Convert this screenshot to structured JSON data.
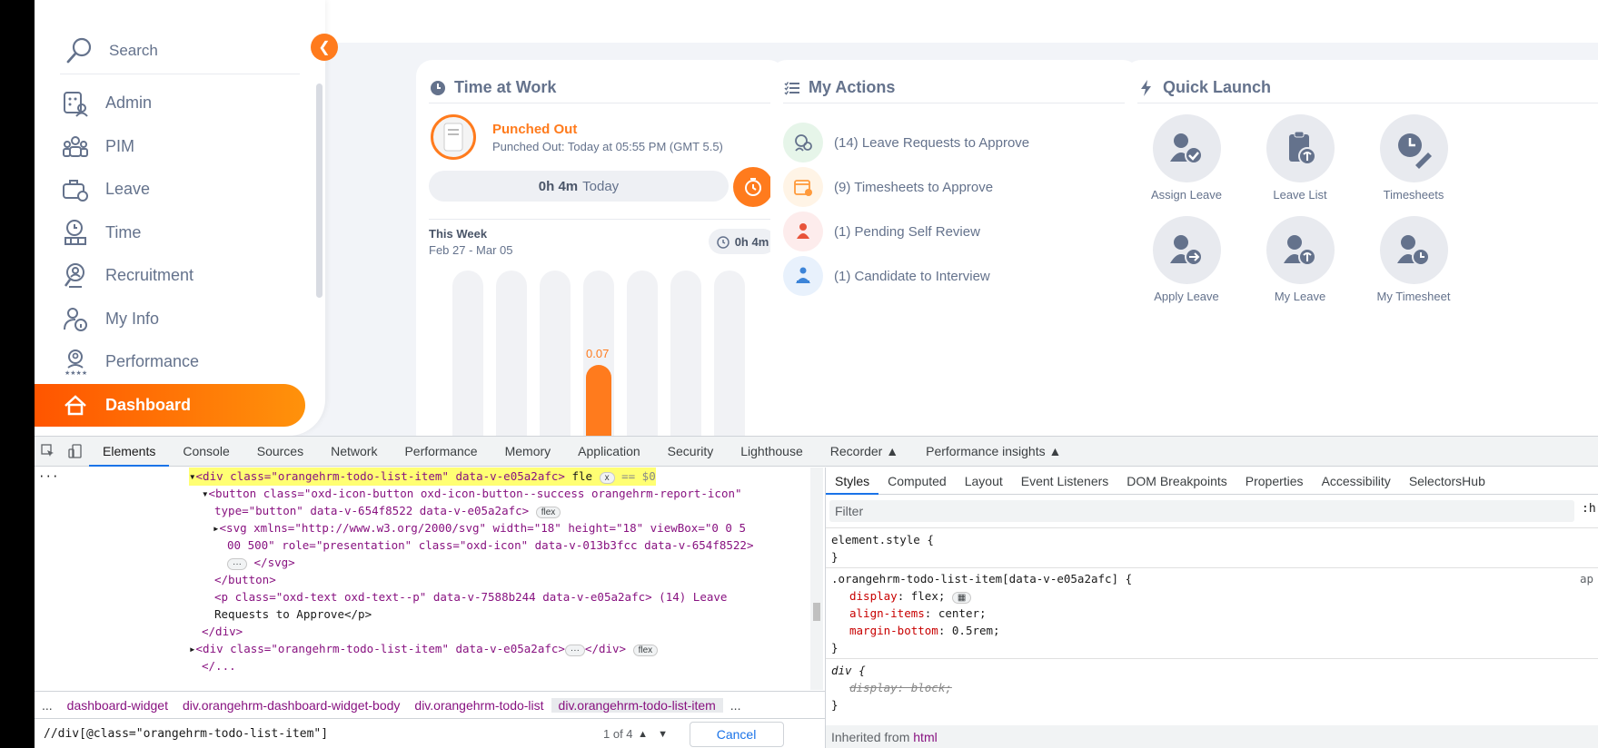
{
  "sidebar": {
    "search_label": "Search",
    "items": [
      {
        "label": "Admin",
        "icon": "admin-icon"
      },
      {
        "label": "PIM",
        "icon": "pim-icon"
      },
      {
        "label": "Leave",
        "icon": "leave-icon"
      },
      {
        "label": "Time",
        "icon": "time-icon"
      },
      {
        "label": "Recruitment",
        "icon": "recruitment-icon"
      },
      {
        "label": "My Info",
        "icon": "my-info-icon"
      },
      {
        "label": "Performance",
        "icon": "performance-icon"
      },
      {
        "label": "Dashboard",
        "icon": "dashboard-icon",
        "active": true
      }
    ],
    "accent": "#ff7b1d"
  },
  "time_at_work": {
    "title": "Time at Work",
    "status": "Punched Out",
    "status_detail": "Punched Out: Today at 05:55 PM (GMT 5.5)",
    "today_hours": "0h 4m",
    "today_label": "Today",
    "week_title": "This Week",
    "week_range": "Feb 27 - Mar 05",
    "week_total": "0h 4m",
    "bar_value_label": "0.07",
    "chart_data": {
      "type": "bar",
      "values": [
        0,
        0,
        0,
        0.07,
        0,
        0,
        0
      ]
    }
  },
  "my_actions": {
    "title": "My Actions",
    "items": [
      {
        "label": "(14) Leave Requests to Approve",
        "icon": "leave-request-icon",
        "bg": "#e6f5e9"
      },
      {
        "label": "(9) Timesheets to Approve",
        "icon": "timesheet-icon",
        "bg": "#fff4e6"
      },
      {
        "label": "(1) Pending Self Review",
        "icon": "self-review-icon",
        "bg": "#fdecec"
      },
      {
        "label": "(1) Candidate to Interview",
        "icon": "candidate-icon",
        "bg": "#e8f1fc"
      }
    ]
  },
  "quick_launch": {
    "title": "Quick Launch",
    "items": [
      {
        "label": "Assign Leave",
        "icon": "assign-leave-icon"
      },
      {
        "label": "Leave List",
        "icon": "leave-list-icon"
      },
      {
        "label": "Timesheets",
        "icon": "timesheets-icon"
      },
      {
        "label": "Apply Leave",
        "icon": "apply-leave-icon"
      },
      {
        "label": "My Leave",
        "icon": "my-leave-icon"
      },
      {
        "label": "My Timesheet",
        "icon": "my-timesheet-icon"
      }
    ]
  },
  "devtools": {
    "tabs": [
      "Elements",
      "Console",
      "Sources",
      "Network",
      "Performance",
      "Memory",
      "Application",
      "Security",
      "Lighthouse",
      "Recorder",
      "Performance insights"
    ],
    "active_tab": "Elements",
    "elements": {
      "line1_tag": "<div class=\"orangehrm-todo-list-item\" data-v-e05a2afc>",
      "line1_suffix": "fle",
      "line1_x": "x",
      "line1_ref": "== $0",
      "line2": "<button class=\"oxd-icon-button oxd-icon-button--success orangehrm-report-icon\"",
      "line3": "type=\"button\" data-v-654f8522 data-v-e05a2afc>",
      "line3_badge": "flex",
      "line4": "<svg xmlns=\"http://www.w3.org/2000/svg\" width=\"18\" height=\"18\" viewBox=\"0 0 5",
      "line5": "00 500\" role=\"presentation\" class=\"oxd-icon\" data-v-013b3fcc data-v-654f8522>",
      "line6": "</svg>",
      "line7": "</button>",
      "line8": "<p class=\"oxd-text oxd-text--p\" data-v-7588b244 data-v-e05a2afc> (14) Leave",
      "line9": "Requests to Approve</p>",
      "line10": "</div>",
      "line11": "<div class=\"orangehrm-todo-list-item\" data-v-e05a2afc>",
      "line11_end": "</div>",
      "line11_badge": "flex",
      "line12": "</..."
    },
    "breadcrumbs": [
      "dashboard-widget",
      "div.orangehrm-dashboard-widget-body",
      "div.orangehrm-todo-list",
      "div.orangehrm-todo-list-item"
    ],
    "breadcrumb_more": "...",
    "find_query": "//div[@class=\"orangehrm-todo-list-item\"]",
    "find_count": "1 of 4",
    "cancel_label": "Cancel",
    "styles_tabs": [
      "Styles",
      "Computed",
      "Layout",
      "Event Listeners",
      "DOM Breakpoints",
      "Properties",
      "Accessibility",
      "SelectorsHub"
    ],
    "filter_placeholder": "Filter",
    "hov_label": ":h",
    "rules": {
      "element_style": "element.style {",
      "close": "}",
      "selector": ".orangehrm-todo-list-item[data-v-e05a2afc] {",
      "source": "ap",
      "p1_name": "display",
      "p1_value": "flex;",
      "p2_name": "align-items",
      "p2_value": "center;",
      "p3_name": "margin-bottom",
      "p3_value": "0.5rem;",
      "div_selector": "div {",
      "div_prop": "display: block;"
    },
    "inherited_label": "Inherited from",
    "inherited_tag": "html"
  }
}
